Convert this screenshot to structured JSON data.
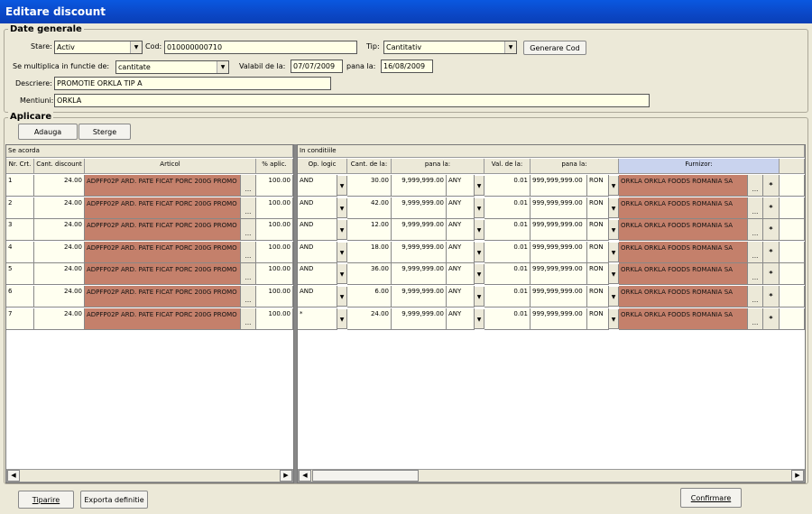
{
  "window": {
    "title": "Editare discount"
  },
  "general": {
    "title": "Date generale",
    "stare_label": "Stare:",
    "stare_value": "Activ",
    "cod_label": "Cod:",
    "cod_value": "010000000710",
    "tip_label": "Tip:",
    "tip_value": "Cantitativ",
    "generate_button": "Generare Cod",
    "multiplica_label": "Se multiplica in  functie de:",
    "multiplica_value": "cantitate",
    "valabil_label": "Valabil de la:",
    "valabil_value": "07/07/2009",
    "pana_label": "pana la:",
    "pana_value": "16/08/2009",
    "descriere_label": "Descriere:",
    "descriere_value": "PROMOTIE ORKLA TIP A",
    "mentiuni_label": "Mentiuni:",
    "mentiuni_value": "ORKLA"
  },
  "apply": {
    "title": "Aplicare",
    "add_button": "Adauga",
    "delete_button": "Sterge",
    "left_section": "Se acorda",
    "right_section": "In conditiile"
  },
  "left_headers": [
    "Nr. Crt.",
    "Cant. discount",
    "Articol",
    "% aplic."
  ],
  "right_headers": [
    "Op. logic",
    "Cant. de la:",
    "pana la:",
    "Val. de la:",
    "pana la:",
    "Furnizor:"
  ],
  "rows": [
    {
      "nr": "1",
      "cant_discount": "24.00",
      "articol": "ADPFP02P ARD. PATE FICAT PORC 200G PROMO",
      "aplic": "100.00",
      "op": "AND",
      "cant_from": "30.00",
      "cant_to": "9,999,999.00",
      "unit": "ANY",
      "val_from": "0.01",
      "val_to": "999,999,999.00",
      "currency": "RON",
      "furnizor": "ORKLA ORKLA FOODS ROMANIA SA"
    },
    {
      "nr": "2",
      "cant_discount": "24.00",
      "articol": "ADPFP02P ARD. PATE FICAT PORC 200G PROMO",
      "aplic": "100.00",
      "op": "AND",
      "cant_from": "42.00",
      "cant_to": "9,999,999.00",
      "unit": "ANY",
      "val_from": "0.01",
      "val_to": "999,999,999.00",
      "currency": "RON",
      "furnizor": "ORKLA ORKLA FOODS ROMANIA SA"
    },
    {
      "nr": "3",
      "cant_discount": "24.00",
      "articol": "ADPFP02P ARD. PATE FICAT PORC 200G PROMO",
      "aplic": "100.00",
      "op": "AND",
      "cant_from": "12.00",
      "cant_to": "9,999,999.00",
      "unit": "ANY",
      "val_from": "0.01",
      "val_to": "999,999,999.00",
      "currency": "RON",
      "furnizor": "ORKLA ORKLA FOODS ROMANIA SA"
    },
    {
      "nr": "4",
      "cant_discount": "24.00",
      "articol": "ADPFP02P ARD. PATE FICAT PORC 200G PROMO",
      "aplic": "100.00",
      "op": "AND",
      "cant_from": "18.00",
      "cant_to": "9,999,999.00",
      "unit": "ANY",
      "val_from": "0.01",
      "val_to": "999,999,999.00",
      "currency": "RON",
      "furnizor": "ORKLA ORKLA FOODS ROMANIA SA"
    },
    {
      "nr": "5",
      "cant_discount": "24.00",
      "articol": "ADPFP02P ARD. PATE FICAT PORC 200G PROMO",
      "aplic": "100.00",
      "op": "AND",
      "cant_from": "36.00",
      "cant_to": "9,999,999.00",
      "unit": "ANY",
      "val_from": "0.01",
      "val_to": "999,999,999.00",
      "currency": "RON",
      "furnizor": "ORKLA ORKLA FOODS ROMANIA SA"
    },
    {
      "nr": "6",
      "cant_discount": "24.00",
      "articol": "ADPFP02P ARD. PATE FICAT PORC 200G PROMO",
      "aplic": "100.00",
      "op": "AND",
      "cant_from": "6.00",
      "cant_to": "9,999,999.00",
      "unit": "ANY",
      "val_from": "0.01",
      "val_to": "999,999,999.00",
      "currency": "RON",
      "furnizor": "ORKLA ORKLA FOODS ROMANIA SA"
    },
    {
      "nr": "7",
      "cant_discount": "24.00",
      "articol": "ADPFP02P ARD. PATE FICAT PORC 200G PROMO",
      "aplic": "100.00",
      "op": "*",
      "cant_from": "24.00",
      "cant_to": "9,999,999.00",
      "unit": "ANY",
      "val_from": "0.01",
      "val_to": "999,999,999.00",
      "currency": "RON",
      "furnizor": "ORKLA ORKLA FOODS ROMANIA SA"
    }
  ],
  "footer": {
    "print_button": "Tiparire",
    "export_button": "Exporta definitie",
    "confirm_button": "Confirmare"
  },
  "icons": {
    "dropdown": "▼",
    "ellipsis": "...",
    "star": "*",
    "scroll_left": "◀",
    "scroll_right": "▶"
  },
  "colors": {
    "title_bar": "#0b47c6",
    "article_cell": "#c4806b",
    "editable_cell": "#fffff0"
  }
}
